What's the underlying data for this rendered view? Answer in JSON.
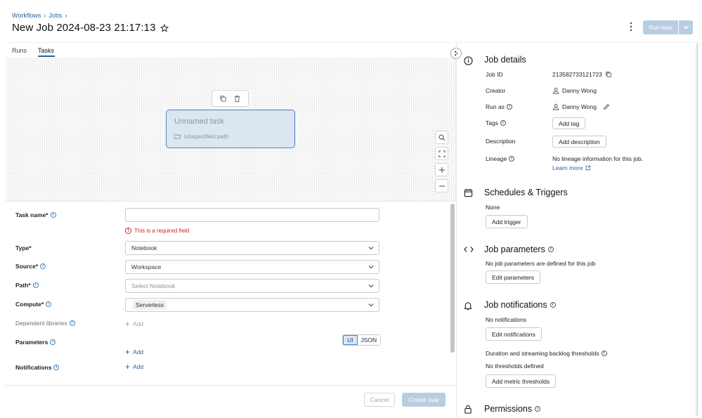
{
  "breadcrumb": [
    "Workflows",
    "Jobs"
  ],
  "job_title": "New Job 2024-08-23 21:17:13",
  "run_now_label": "Run now",
  "tabs": [
    "Runs",
    "Tasks"
  ],
  "active_tab": "Tasks",
  "task_node": {
    "name": "Unnamed task",
    "path": "Unspecified path"
  },
  "form": {
    "task_name_label": "Task name*",
    "task_name_value": "",
    "required_error": "This is a required field",
    "type_label": "Type*",
    "type_value": "Notebook",
    "source_label": "Source*",
    "source_value": "Workspace",
    "path_label": "Path*",
    "path_placeholder": "Select Notebook",
    "compute_label": "Compute*",
    "compute_value": "Serverless",
    "dependent_libraries_label": "Dependent libraries",
    "parameters_label": "Parameters",
    "notifications_label": "Notifications",
    "add_label": "Add",
    "toggle_ui": "UI",
    "toggle_json": "JSON",
    "cancel_label": "Cancel",
    "create_label": "Create task"
  },
  "job_details": {
    "title": "Job details",
    "job_id_label": "Job ID",
    "job_id": "213582733121723",
    "creator_label": "Creator",
    "creator": "Danny Wong",
    "run_as_label": "Run as",
    "run_as": "Danny Wong",
    "tags_label": "Tags",
    "add_tag": "Add tag",
    "description_label": "Description",
    "add_description": "Add description",
    "lineage_label": "Lineage",
    "lineage_text": "No lineage information for this job.",
    "learn_more": "Learn more"
  },
  "schedules": {
    "title": "Schedules & Triggers",
    "value": "None",
    "add_trigger": "Add trigger"
  },
  "job_parameters": {
    "title": "Job parameters",
    "text": "No job parameters are defined for this job",
    "edit": "Edit parameters"
  },
  "job_notifications": {
    "title": "Job notifications",
    "text": "No notifications",
    "edit": "Edit notifications",
    "thresholds_label": "Duration and streaming backlog thresholds",
    "thresholds_text": "No thresholds defined",
    "add_thresholds": "Add metric thresholds"
  },
  "permissions": {
    "title": "Permissions"
  },
  "colors": {
    "accent": "#2563a8",
    "disabled_primary": "#b9cde2",
    "error": "#c62828",
    "node_fill": "#dbe6f1"
  }
}
